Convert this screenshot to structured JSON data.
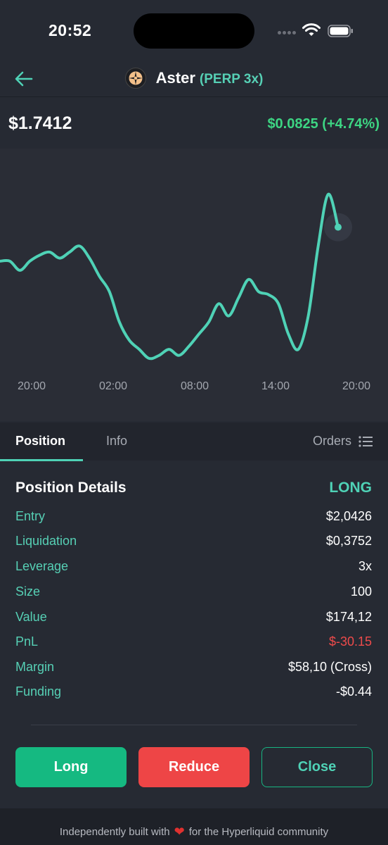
{
  "status_bar": {
    "time": "20:52"
  },
  "header": {
    "title": "Aster",
    "subtitle": "(PERP 3x)"
  },
  "price_row": {
    "price": "$1.7412",
    "change": "$0.0825 (+4.74%)"
  },
  "chart_data": {
    "type": "line",
    "x_ticks": [
      "20:00",
      "02:00",
      "08:00",
      "14:00",
      "20:00"
    ],
    "values": [
      1.73,
      1.73,
      1.727,
      1.73,
      1.732,
      1.733,
      1.731,
      1.733,
      1.735,
      1.731,
      1.725,
      1.72,
      1.71,
      1.704,
      1.701,
      1.698,
      1.699,
      1.701,
      1.699,
      1.702,
      1.706,
      1.71,
      1.716,
      1.712,
      1.718,
      1.724,
      1.72,
      1.719,
      1.716,
      1.706,
      1.701,
      1.712,
      1.735,
      1.752,
      1.7412
    ],
    "colors": {
      "line": "#4fd2b6"
    }
  },
  "tabs": {
    "position": "Position",
    "info": "Info",
    "orders": "Orders"
  },
  "details": {
    "title": "Position Details",
    "side": "LONG",
    "rows": [
      {
        "label": "Entry",
        "value": "$2,0426"
      },
      {
        "label": "Liquidation",
        "value": "$0,3752"
      },
      {
        "label": "Leverage",
        "value": "3x"
      },
      {
        "label": "Size",
        "value": "100"
      },
      {
        "label": "Value",
        "value": "$174,12"
      },
      {
        "label": "PnL",
        "value": "$-30.15"
      },
      {
        "label": "Margin",
        "value": "$58,10 (Cross)"
      },
      {
        "label": "Funding",
        "value": "-$0.44"
      }
    ]
  },
  "buttons": {
    "long": "Long",
    "reduce": "Reduce",
    "close": "Close"
  },
  "footer": {
    "before": "Independently built with",
    "after": "for the Hyperliquid community"
  },
  "colors": {
    "accent": "#4fd2b6",
    "positive": "#3dd583",
    "negative": "#ef4b4b",
    "long": "#15b981",
    "reduce": "#ee4546"
  }
}
